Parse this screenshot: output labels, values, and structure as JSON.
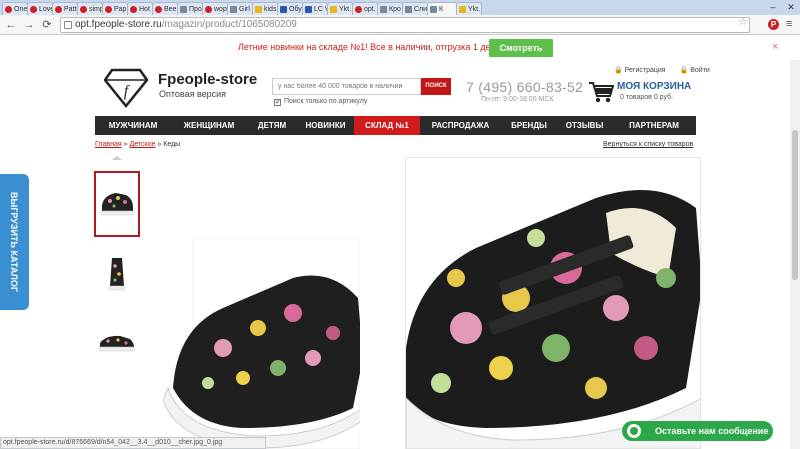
{
  "browser": {
    "tabs": [
      {
        "label": "One",
        "icon": "pinterest"
      },
      {
        "label": "Love",
        "icon": "pinterest"
      },
      {
        "label": "Patt",
        "icon": "pinterest"
      },
      {
        "label": "simp",
        "icon": "pinterest"
      },
      {
        "label": "Pap",
        "icon": "pinterest"
      },
      {
        "label": "Hot",
        "icon": "pinterest"
      },
      {
        "label": "Bee",
        "icon": "pinterest"
      },
      {
        "label": "Про",
        "icon": "generic"
      },
      {
        "label": "wop",
        "icon": "pinterest"
      },
      {
        "label": "Girl",
        "icon": "generic"
      },
      {
        "label": "kids",
        "icon": "yellow"
      },
      {
        "label": "Обу",
        "icon": "low"
      },
      {
        "label": "LC V",
        "icon": "low"
      },
      {
        "label": "Ykt.",
        "icon": "yellow"
      },
      {
        "label": "opt.",
        "icon": "pinterest"
      },
      {
        "label": "Кро",
        "icon": "generic"
      },
      {
        "label": "Сли",
        "icon": "generic"
      },
      {
        "label": "К",
        "icon": "generic",
        "active": true
      },
      {
        "label": "Ykt.",
        "icon": "yellow"
      }
    ],
    "url_host": "opt.fpeople-store.ru",
    "url_path": "/magazin/product/1065080209",
    "status_url": "opt.fpeople-store.ru/d/876669/d/n54_042__3.4__d010__cher.jpg_0.jpg"
  },
  "notice": {
    "text": "Летние новинки на складе №1! Все в наличии, отгрузка 1 день!",
    "button": "Смотреть",
    "close": "×"
  },
  "header": {
    "logo_name": "Fpeople-store",
    "logo_sub": "Оптовая версия",
    "search_placeholder": "у нас более 40 000 товаров в наличии",
    "search_button": "ПОИСК",
    "article_only": "Поиск только по артикулу",
    "phone": "7 (495) 660-83-52",
    "hours": "Пн-пт: 9:00-18:00 МСК",
    "register": "Регистрация",
    "login": "Войти",
    "cart_title": "МОЯ КОРЗИНА",
    "cart_summary": "0 товаров 0 руб."
  },
  "nav": [
    {
      "label": "МУЖЧИНАМ",
      "w": 76
    },
    {
      "label": "ЖЕНЩИНАМ",
      "w": 76
    },
    {
      "label": "ДЕТЯМ",
      "w": 50
    },
    {
      "label": "НОВИНКИ",
      "w": 57
    },
    {
      "label": "СКЛАД №1",
      "w": 66,
      "active": true
    },
    {
      "label": "РАСПРОДАЖА",
      "w": 81
    },
    {
      "label": "БРЕНДЫ",
      "w": 56
    },
    {
      "label": "ОТЗЫВЫ",
      "w": 55
    },
    {
      "label": "ПАРТНЕРАМ",
      "w": 84
    }
  ],
  "breadcrumb": {
    "home": "Главная",
    "sep": "»",
    "category": "Детское",
    "current": "Кеды"
  },
  "back_link": "Вернуться к списку товаров",
  "side_tab": "ВЫГРУЗИТЬ КАТАЛОГ",
  "chat": "Оставьте нам сообщение",
  "colors": {
    "accent_red": "#cf1b1b",
    "nav_dark": "#2b2b2b",
    "side_blue": "#3a8fd2",
    "chat_green": "#2ca84b",
    "notice_green": "#5cc04a"
  }
}
